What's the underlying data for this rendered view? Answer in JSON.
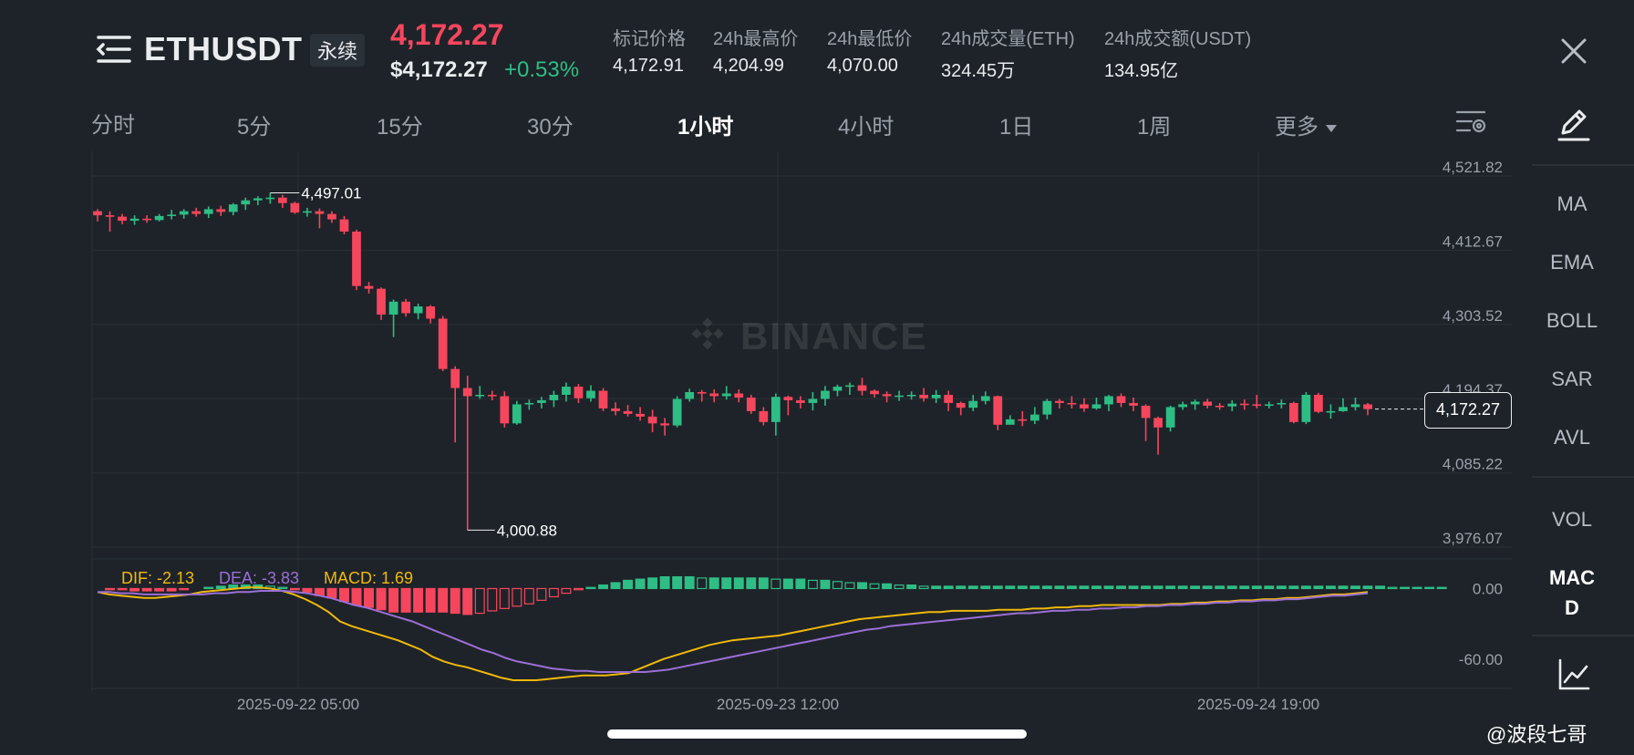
{
  "header": {
    "symbol": "ETHUSDT",
    "badge": "永续",
    "last_price": "4,172.27",
    "usd_price": "$4,172.27",
    "change_pct": "+0.53%",
    "stats": [
      {
        "label": "标记价格",
        "value": "4,172.91"
      },
      {
        "label": "24h最高价",
        "value": "4,204.99"
      },
      {
        "label": "24h最低价",
        "value": "4,070.00"
      },
      {
        "label": "24h成交量(ETH)",
        "value": "324.45万"
      },
      {
        "label": "24h成交额(USDT)",
        "value": "134.95亿"
      }
    ]
  },
  "tabs": [
    "分时",
    "5分",
    "15分",
    "30分",
    "1小时",
    "4小时",
    "1日",
    "1周",
    "更多"
  ],
  "active_tab": "1小时",
  "indicators": [
    "MA",
    "EMA",
    "BOLL",
    "SAR",
    "AVL",
    "VOL",
    "MACD"
  ],
  "active_indicator": "MACD",
  "colors": {
    "up": "#2ebd85",
    "down": "#f6465d",
    "dif": "#f0b90b",
    "dea": "#9b6fd6",
    "macd": "#f0b90b"
  },
  "chart_data": {
    "type": "candlestick",
    "timeframe": "1小时",
    "watermark": "BINANCE",
    "y_ticks": [
      "4,521.82",
      "4,412.67",
      "4,303.52",
      "4,194.37",
      "4,085.22",
      "3,976.07"
    ],
    "ylim": [
      3976.07,
      4521.82
    ],
    "x_ticks": [
      "2025-09-22 05:00",
      "2025-09-23 12:00",
      "2025-09-24 19:00"
    ],
    "high_marker": "4,497.01",
    "low_marker": "4,000.88",
    "current_price": "4,172.27",
    "candles": [
      [
        4470,
        4464,
        4473,
        4455
      ],
      [
        4464,
        4462,
        4470,
        4440
      ],
      [
        4462,
        4456,
        4466,
        4451
      ],
      [
        4456,
        4459,
        4464,
        4450
      ],
      [
        4459,
        4457,
        4464,
        4453
      ],
      [
        4457,
        4463,
        4466,
        4455
      ],
      [
        4463,
        4465,
        4472,
        4458
      ],
      [
        4465,
        4470,
        4473,
        4459
      ],
      [
        4470,
        4466,
        4475,
        4462
      ],
      [
        4466,
        4473,
        4477,
        4460
      ],
      [
        4473,
        4469,
        4478,
        4463
      ],
      [
        4469,
        4480,
        4482,
        4464
      ],
      [
        4480,
        4486,
        4490,
        4472
      ],
      [
        4486,
        4489,
        4492,
        4479
      ],
      [
        4489,
        4490,
        4497,
        4481
      ],
      [
        4490,
        4482,
        4494,
        4475
      ],
      [
        4482,
        4468,
        4484,
        4466
      ],
      [
        4468,
        4470,
        4475,
        4462
      ],
      [
        4470,
        4466,
        4474,
        4445
      ],
      [
        4466,
        4458,
        4470,
        4453
      ],
      [
        4458,
        4440,
        4463,
        4436
      ],
      [
        4440,
        4360,
        4443,
        4354
      ],
      [
        4360,
        4356,
        4366,
        4349
      ],
      [
        4356,
        4318,
        4358,
        4310
      ],
      [
        4318,
        4337,
        4340,
        4285
      ],
      [
        4337,
        4320,
        4341,
        4315
      ],
      [
        4320,
        4330,
        4334,
        4311
      ],
      [
        4330,
        4312,
        4332,
        4305
      ],
      [
        4312,
        4238,
        4316,
        4235
      ],
      [
        4238,
        4210,
        4242,
        4130
      ],
      [
        4210,
        4198,
        4228,
        4001
      ],
      [
        4198,
        4200,
        4213,
        4194
      ],
      [
        4200,
        4198,
        4206,
        4192
      ],
      [
        4198,
        4158,
        4205,
        4152
      ],
      [
        4158,
        4186,
        4191,
        4156
      ],
      [
        4186,
        4188,
        4193,
        4178
      ],
      [
        4188,
        4192,
        4197,
        4180
      ],
      [
        4192,
        4200,
        4206,
        4182
      ],
      [
        4200,
        4212,
        4218,
        4190
      ],
      [
        4212,
        4195,
        4216,
        4188
      ],
      [
        4195,
        4206,
        4214,
        4190
      ],
      [
        4206,
        4180,
        4210,
        4176
      ],
      [
        4180,
        4176,
        4189,
        4170
      ],
      [
        4176,
        4172,
        4185,
        4168
      ],
      [
        4172,
        4168,
        4182,
        4162
      ],
      [
        4168,
        4158,
        4178,
        4145
      ],
      [
        4158,
        4155,
        4166,
        4140
      ],
      [
        4155,
        4194,
        4198,
        4152
      ],
      [
        4194,
        4204,
        4209,
        4190
      ],
      [
        4204,
        4202,
        4207,
        4190
      ],
      [
        4202,
        4198,
        4208,
        4189
      ],
      [
        4198,
        4202,
        4213,
        4193
      ],
      [
        4202,
        4196,
        4208,
        4189
      ],
      [
        4196,
        4176,
        4200,
        4172
      ],
      [
        4176,
        4160,
        4182,
        4155
      ],
      [
        4160,
        4197,
        4202,
        4140
      ],
      [
        4197,
        4192,
        4199,
        4170
      ],
      [
        4192,
        4188,
        4198,
        4180
      ],
      [
        4188,
        4194,
        4204,
        4177
      ],
      [
        4194,
        4206,
        4213,
        4184
      ],
      [
        4206,
        4212,
        4215,
        4198
      ],
      [
        4212,
        4214,
        4218,
        4200
      ],
      [
        4214,
        4206,
        4225,
        4199
      ],
      [
        4206,
        4201,
        4208,
        4196
      ],
      [
        4201,
        4198,
        4205,
        4189
      ],
      [
        4198,
        4199,
        4206,
        4191
      ],
      [
        4199,
        4200,
        4205,
        4193
      ],
      [
        4200,
        4195,
        4210,
        4190
      ],
      [
        4195,
        4200,
        4207,
        4188
      ],
      [
        4200,
        4188,
        4206,
        4176
      ],
      [
        4188,
        4181,
        4190,
        4170
      ],
      [
        4181,
        4191,
        4200,
        4176
      ],
      [
        4191,
        4198,
        4205,
        4186
      ],
      [
        4198,
        4156,
        4199,
        4148
      ],
      [
        4156,
        4164,
        4170,
        4158
      ],
      [
        4164,
        4162,
        4176,
        4154
      ],
      [
        4162,
        4171,
        4182,
        4157
      ],
      [
        4171,
        4191,
        4194,
        4164
      ],
      [
        4191,
        4188,
        4194,
        4180
      ],
      [
        4188,
        4186,
        4198,
        4180
      ],
      [
        4186,
        4180,
        4195,
        4175
      ],
      [
        4180,
        4186,
        4196,
        4178
      ],
      [
        4186,
        4198,
        4200,
        4176
      ],
      [
        4198,
        4188,
        4202,
        4182
      ],
      [
        4188,
        4184,
        4196,
        4176
      ],
      [
        4184,
        4166,
        4186,
        4132
      ],
      [
        4166,
        4152,
        4168,
        4112
      ],
      [
        4152,
        4182,
        4184,
        4146
      ],
      [
        4182,
        4186,
        4190,
        4178
      ],
      [
        4186,
        4190,
        4193,
        4178
      ],
      [
        4190,
        4184,
        4194,
        4180
      ],
      [
        4184,
        4183,
        4188,
        4178
      ],
      [
        4183,
        4187,
        4192,
        4176
      ],
      [
        4187,
        4186,
        4193,
        4178
      ],
      [
        4186,
        4185,
        4200,
        4180
      ],
      [
        4185,
        4186,
        4190,
        4180
      ],
      [
        4186,
        4188,
        4193,
        4180
      ],
      [
        4188,
        4160,
        4190,
        4158
      ],
      [
        4160,
        4200,
        4204,
        4157
      ],
      [
        4200,
        4175,
        4203,
        4173
      ],
      [
        4175,
        4176,
        4186,
        4165
      ],
      [
        4176,
        4182,
        4195,
        4175
      ],
      [
        4182,
        4186,
        4196,
        4177
      ],
      [
        4186,
        4179,
        4188,
        4170
      ]
    ],
    "macd": {
      "dif_label": "DIF: -2.13",
      "dea_label": "DEA: -3.83",
      "macd_label": "MACD: 1.69",
      "y_ticks": [
        "0.00",
        "-60.00"
      ],
      "ylim": [
        -85,
        12
      ],
      "dif": [
        -3,
        -5,
        -6,
        -7,
        -8,
        -8,
        -7,
        -6,
        -5,
        -3,
        -2,
        -1,
        0,
        1,
        1,
        0,
        -2,
        -5,
        -9,
        -14,
        -20,
        -28,
        -32,
        -35,
        -38,
        -41,
        -44,
        -48,
        -52,
        -58,
        -62,
        -65,
        -67,
        -70,
        -73,
        -76,
        -78,
        -78,
        -78,
        -77,
        -76,
        -75,
        -74,
        -74,
        -74,
        -73,
        -72,
        -68,
        -64,
        -60,
        -57,
        -54,
        -51,
        -48,
        -46,
        -44,
        -43,
        -42,
        -41,
        -40,
        -38,
        -36,
        -34,
        -32,
        -30,
        -28,
        -26,
        -25,
        -24,
        -23,
        -22,
        -21,
        -20,
        -20,
        -19,
        -19,
        -19,
        -19,
        -18,
        -18,
        -18,
        -17,
        -17,
        -16,
        -16,
        -15,
        -15,
        -14,
        -14,
        -14,
        -14,
        -14,
        -14,
        -13,
        -13,
        -12,
        -12,
        -11,
        -11,
        -10,
        -10,
        -9,
        -9,
        -8,
        -8,
        -7,
        -6,
        -5,
        -5,
        -4,
        -3
      ],
      "dea": [
        -3,
        -3,
        -4,
        -4,
        -5,
        -5,
        -5,
        -5,
        -5,
        -5,
        -4,
        -4,
        -3,
        -3,
        -2,
        -2,
        -2,
        -3,
        -4,
        -6,
        -8,
        -11,
        -14,
        -16,
        -19,
        -22,
        -25,
        -28,
        -32,
        -36,
        -40,
        -44,
        -48,
        -52,
        -55,
        -59,
        -62,
        -64,
        -66,
        -68,
        -69,
        -70,
        -70,
        -71,
        -71,
        -71,
        -71,
        -71,
        -70,
        -69,
        -67,
        -65,
        -63,
        -61,
        -59,
        -57,
        -55,
        -53,
        -51,
        -49,
        -47,
        -45,
        -43,
        -41,
        -39,
        -37,
        -35,
        -34,
        -32,
        -31,
        -30,
        -29,
        -28,
        -27,
        -26,
        -25,
        -24,
        -23,
        -22,
        -21,
        -21,
        -20,
        -19,
        -19,
        -18,
        -18,
        -17,
        -17,
        -16,
        -16,
        -15,
        -15,
        -14,
        -14,
        -13,
        -13,
        -12,
        -12,
        -11,
        -11,
        -10,
        -10,
        -9,
        -9,
        -8,
        -7,
        -6,
        -6,
        -5,
        -4
      ],
      "hist": [
        0,
        -1,
        -1,
        -2,
        -2,
        -2,
        -2,
        -1,
        0,
        1,
        2,
        3,
        3,
        3,
        2,
        1,
        -1,
        -3,
        -6,
        -8,
        -11,
        -14,
        -16,
        -18,
        -20,
        -20,
        -20,
        -20,
        -20,
        -21,
        -22,
        -21,
        -19,
        -17,
        -15,
        -13,
        -10,
        -7,
        -4,
        -1,
        1,
        3,
        5,
        7,
        8,
        9,
        10,
        10,
        10,
        9,
        9,
        9,
        9,
        9,
        9,
        8,
        8,
        8,
        7,
        7,
        6,
        5,
        5,
        4,
        4,
        3,
        3,
        2,
        2,
        2,
        2,
        2,
        2,
        2,
        2,
        2,
        2,
        2,
        2,
        2,
        2,
        2,
        2,
        2,
        2,
        2,
        2,
        2,
        2,
        2,
        2,
        2,
        2,
        2,
        2,
        2,
        2,
        2,
        2,
        2,
        2,
        2,
        2,
        2,
        2,
        1,
        1,
        1,
        1,
        1
      ]
    }
  },
  "credit": "@波段七哥"
}
